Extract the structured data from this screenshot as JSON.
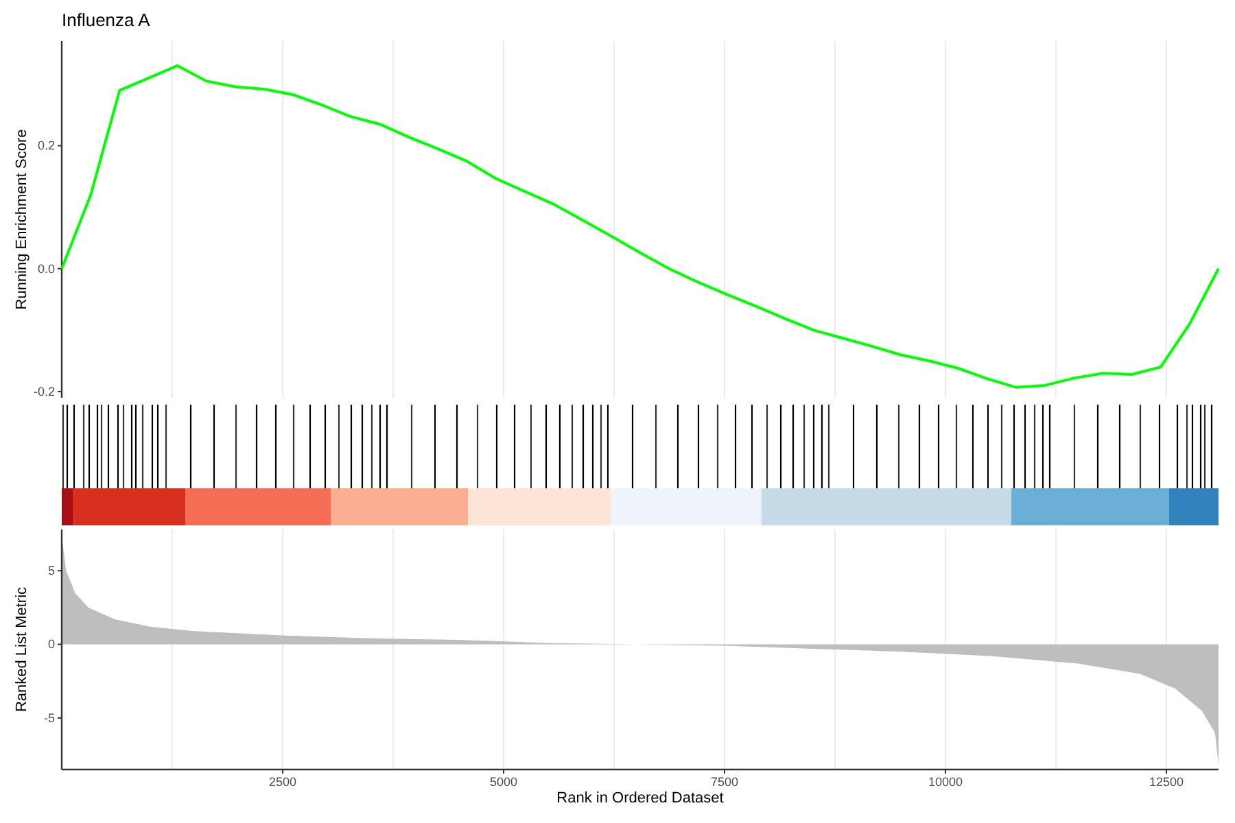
{
  "title": "Influenza A",
  "es_plot": {
    "chart_data": {
      "type": "line",
      "ylabel": "Running Enrichment Score",
      "grid": true,
      "ylim": [
        -0.21,
        0.37
      ],
      "yticks": [
        {
          "value": -0.2,
          "label": "-0.2"
        },
        {
          "value": 0,
          "label": "0.0"
        },
        {
          "value": 0.2,
          "label": "0.2"
        }
      ],
      "series": [
        {
          "color": "#00ff00",
          "values": [
            0,
            0.12,
            0.29,
            0.31,
            0.33,
            0.305,
            0.296,
            0.292,
            0.283,
            0.266,
            0.247,
            0.235,
            0.214,
            0.195,
            0.175,
            0.147,
            0.126,
            0.105,
            0.079,
            0.053,
            0.026,
            0,
            -0.022,
            -0.042,
            -0.061,
            -0.081,
            -0.1,
            -0.113,
            -0.126,
            -0.14,
            -0.15,
            -0.162,
            -0.179,
            -0.193,
            -0.19,
            -0.178,
            -0.17,
            -0.172,
            -0.16,
            -0.09,
            0
          ]
        }
      ]
    }
  },
  "metric_plot": {
    "chart_data": {
      "type": "area",
      "xlabel": "Rank in Ordered Dataset",
      "ylabel": "Ranked List Metric",
      "xlim": [
        0,
        13090
      ],
      "ylim": [
        -8.5,
        7.8
      ],
      "xticks": [
        2500,
        5000,
        7500,
        10000,
        12500
      ],
      "grid": true,
      "yticks": [
        -5,
        0,
        5
      ],
      "series": [
        {
          "color": "#bebebe",
          "x": [
            0,
            50,
            150,
            300,
            600,
            1000,
            1500,
            2500,
            3500,
            4500,
            5500,
            6500,
            7500,
            8500,
            9500,
            10500,
            11500,
            12200,
            12600,
            12900,
            13050,
            13090
          ],
          "values": [
            7.4,
            5,
            3.5,
            2.5,
            1.7,
            1.2,
            0.9,
            0.6,
            0.4,
            0.3,
            0.1,
            0,
            -0.1,
            -0.3,
            -0.5,
            -0.8,
            -1.3,
            -2,
            -3,
            -4.5,
            -6,
            -8.2
          ]
        }
      ]
    }
  }
}
